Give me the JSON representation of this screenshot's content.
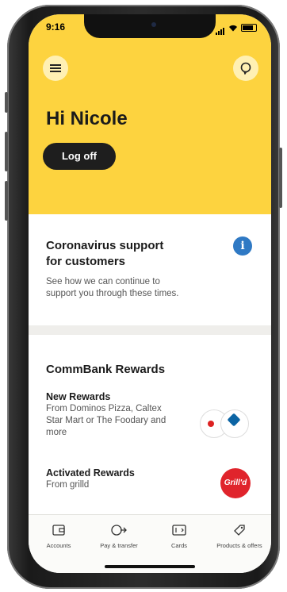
{
  "status": {
    "time": "9:16"
  },
  "header": {
    "greeting": "Hi Nicole",
    "logoff_label": "Log off",
    "menu_icon": "hamburger-menu-icon",
    "help_icon": "chat-help-icon"
  },
  "covid_card": {
    "title_line1": "Coronavirus support",
    "title_line2": "for customers",
    "body_line1": "See how we can continue to",
    "body_line2": "support you through these times."
  },
  "rewards_card": {
    "title": "CommBank Rewards",
    "new_title": "New Rewards",
    "new_line1": "From Dominos Pizza, Caltex",
    "new_line2": "Star Mart or The Foodary and",
    "new_line3": "more",
    "activated_title": "Activated Rewards",
    "activated_sub": "From grilld",
    "grilld_logo_text": "Grill'd"
  },
  "tabs": [
    {
      "label": "Accounts",
      "icon": "accounts-icon"
    },
    {
      "label": "Pay & transfer",
      "icon": "pay-transfer-icon"
    },
    {
      "label": "Cards",
      "icon": "cards-icon"
    },
    {
      "label": "Products & offers",
      "icon": "products-offers-icon"
    }
  ],
  "colors": {
    "brand_yellow": "#fdd33f",
    "info_blue": "#2f79c4",
    "grilld_red": "#e0242c"
  }
}
